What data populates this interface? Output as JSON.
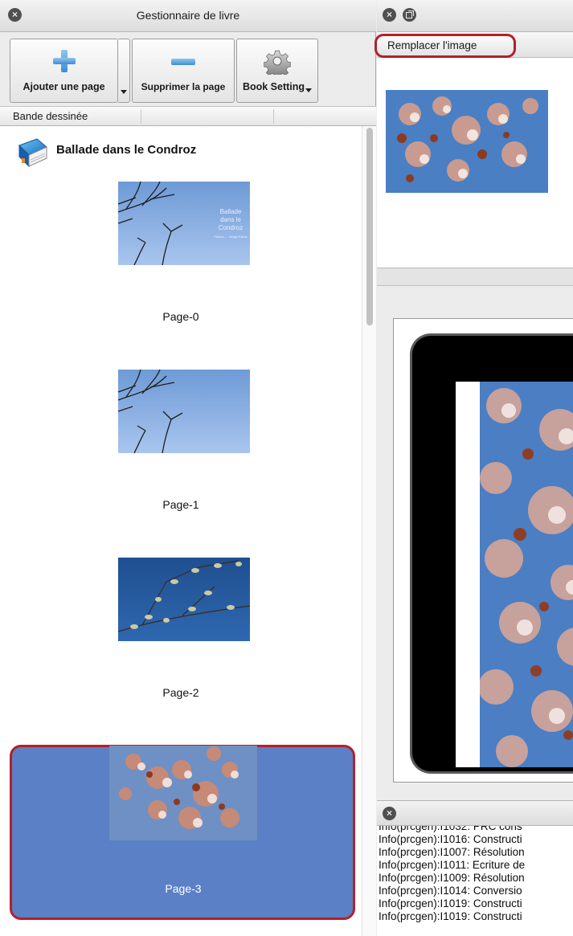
{
  "left_panel": {
    "title": "Gestionnaire de livre",
    "toolbar": {
      "add_page_label": "Ajouter une page",
      "delete_page_label": "Supprimer la page",
      "book_settings_label": "Book Setting"
    },
    "list_header": {
      "col1": "Bande dessinée",
      "col2": "",
      "col3": ""
    },
    "book": {
      "title": "Ballade dans le Condroz"
    },
    "cover_text": [
      "Ballade",
      "dans le",
      "Condroz"
    ],
    "cover_credit": "Photos — Serge Kalms",
    "pages": [
      {
        "label": "Page-0"
      },
      {
        "label": "Page-1"
      },
      {
        "label": "Page-2"
      },
      {
        "label": "Page-3",
        "selected": true
      }
    ]
  },
  "right_panel": {
    "replace_image_label": "Remplacer l'image",
    "console_lines": [
      "Info(prcgen):I1032: PRC cons",
      "Info(prcgen):I1016: Constructi",
      "Info(prcgen):I1007: Résolution",
      "Info(prcgen):I1011: Ecriture de",
      "Info(prcgen):I1009: Résolution",
      "Info(prcgen):I1014: Conversio",
      "Info(prcgen):I1019: Constructi",
      "Info(prcgen):I1019: Constructi"
    ]
  },
  "colors": {
    "selection": "#5b80c6",
    "highlight_ring": "#b3202a",
    "sky": "#4a7fc4"
  },
  "icons": {
    "close": "close-icon",
    "restore": "restore-window-icon",
    "add": "plus-icon",
    "remove": "minus-icon",
    "settings": "gear-icon",
    "book": "book-icon"
  }
}
